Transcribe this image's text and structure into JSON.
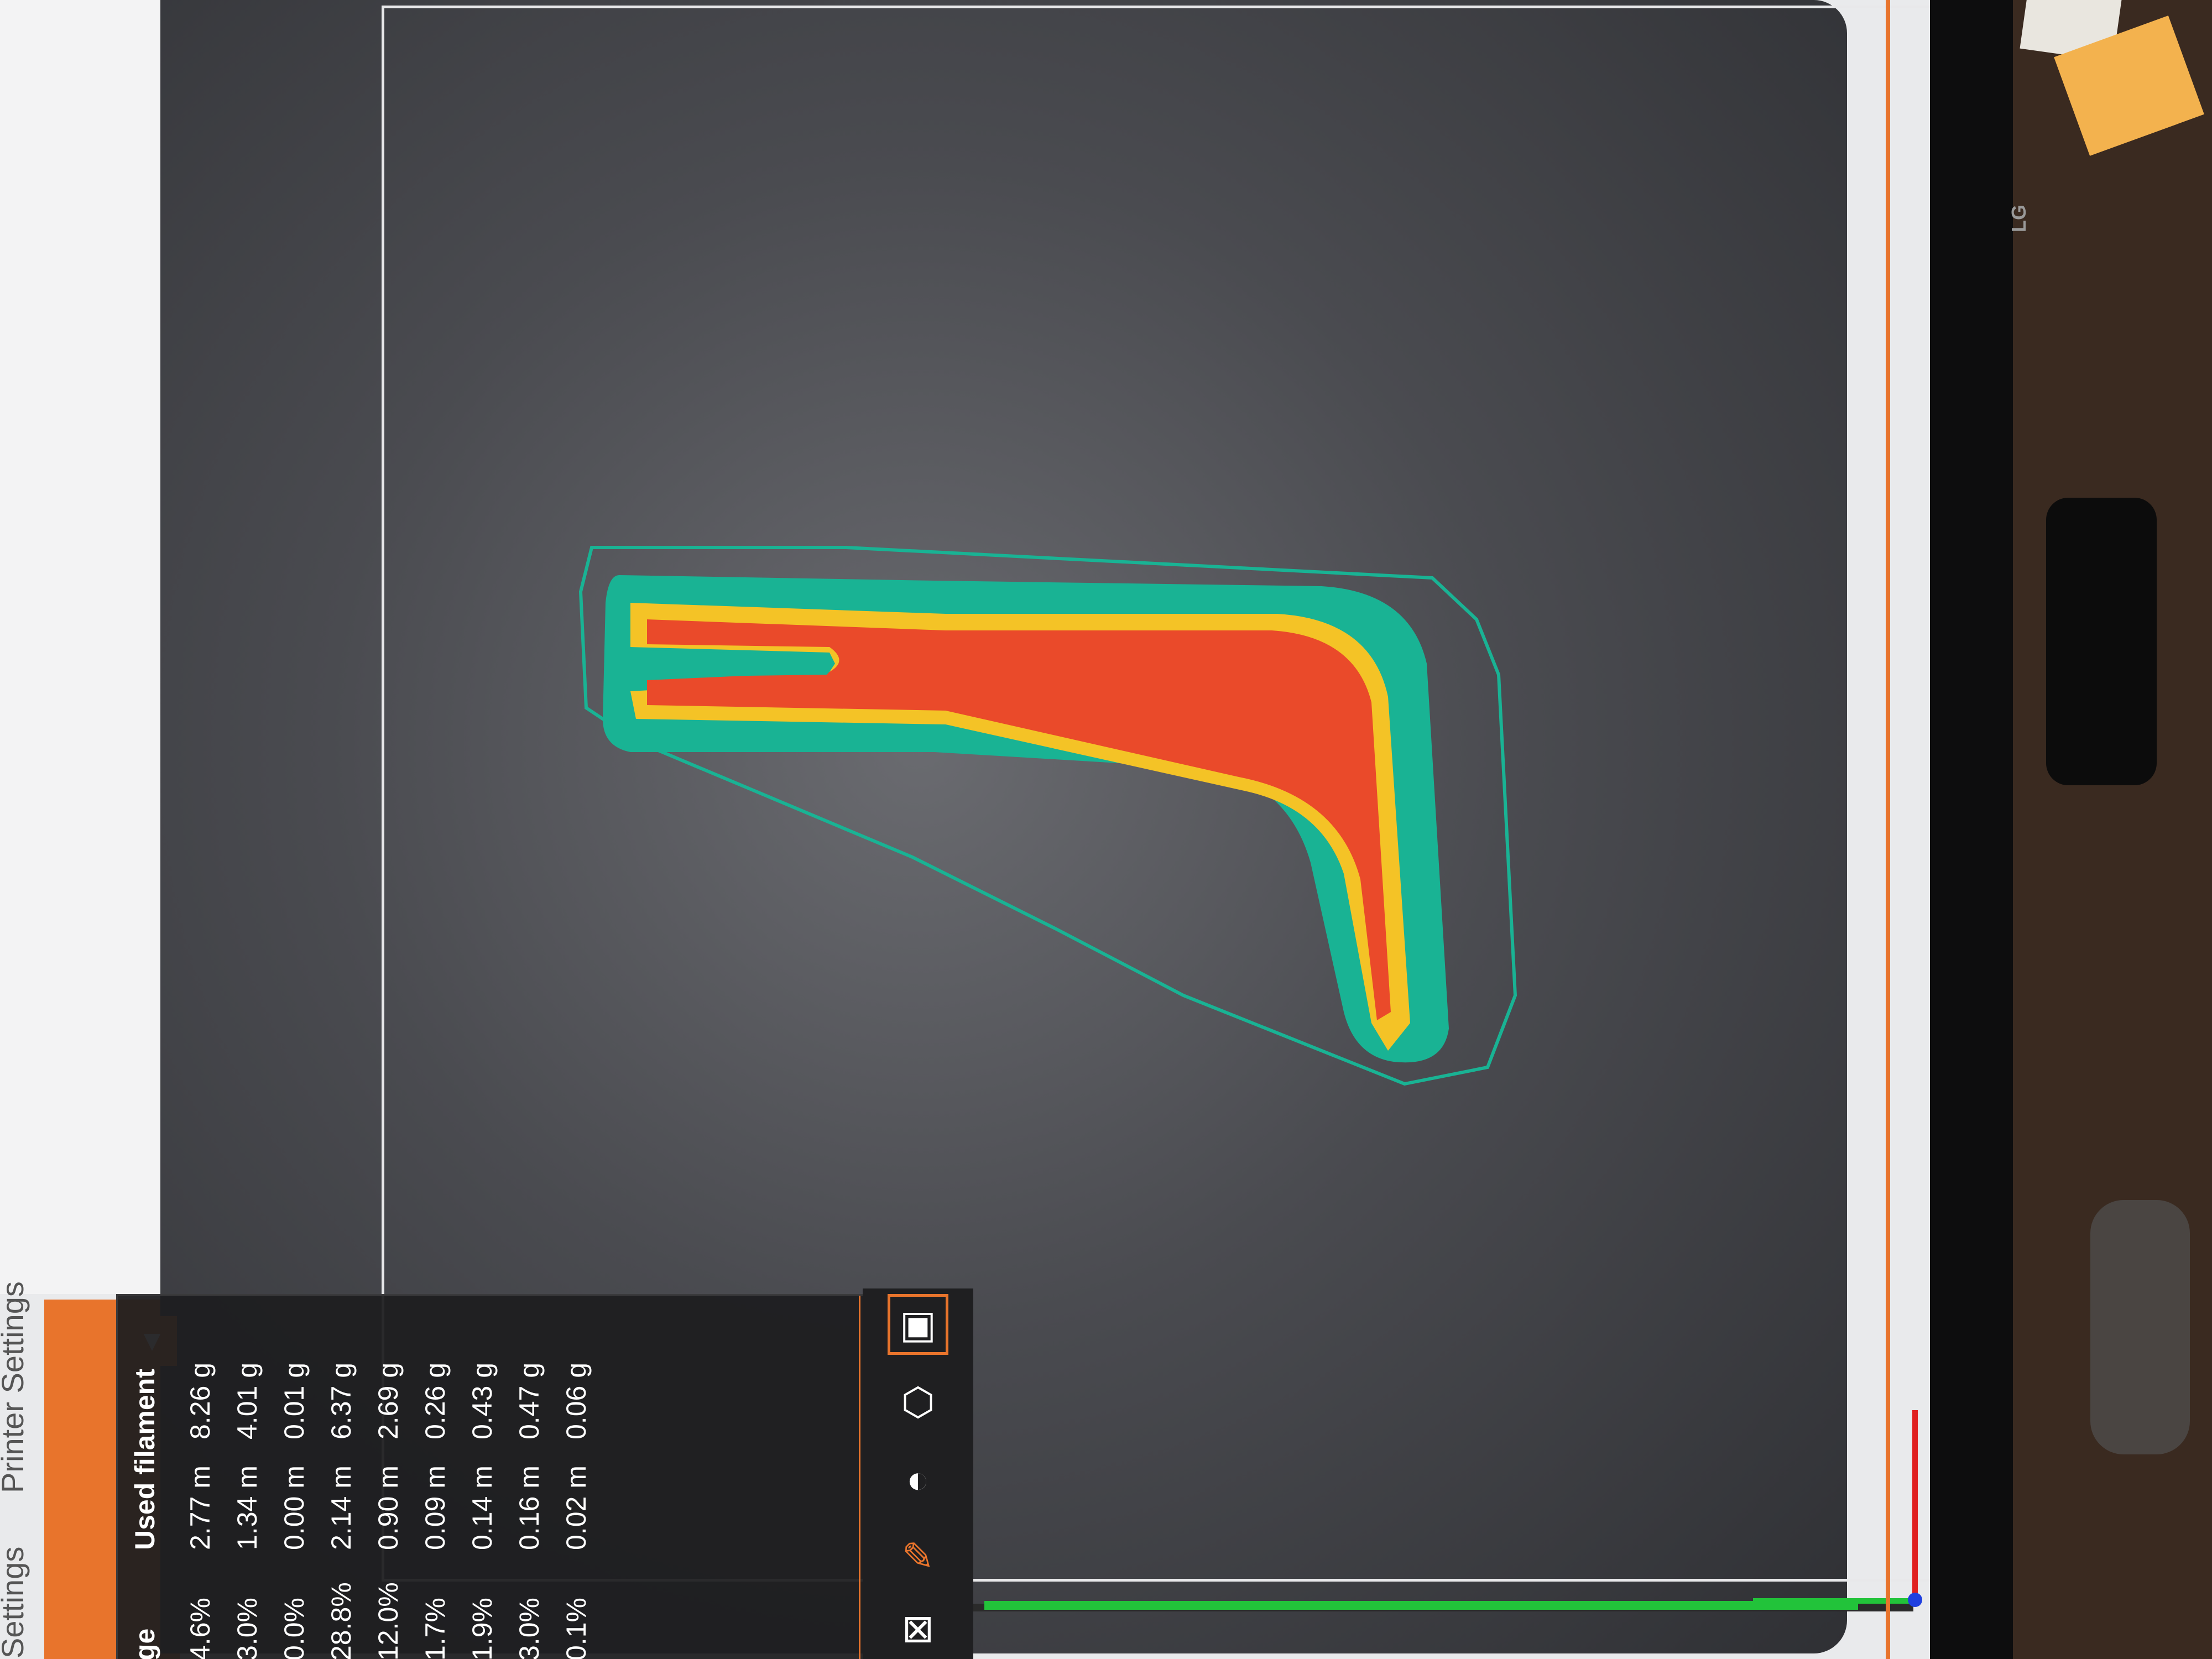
{
  "app": {
    "tabs": [
      {
        "label": "Settings"
      },
      {
        "label": "Printer Settings"
      }
    ],
    "collapse_icon": "triangle-down-icon"
  },
  "legend": {
    "header_left": "ge",
    "header_right": "Used filament",
    "rows": [
      {
        "pct": "4.6%",
        "len": "2.77 m",
        "wt": "8.26 g"
      },
      {
        "pct": "3.0%",
        "len": "1.34 m",
        "wt": "4.01 g"
      },
      {
        "pct": "0.0%",
        "len": "0.00 m",
        "wt": "0.01 g"
      },
      {
        "pct": "28.8%",
        "len": "2.14 m",
        "wt": "6.37 g"
      },
      {
        "pct": "12.0%",
        "len": "0.90 m",
        "wt": "2.69 g"
      },
      {
        "pct": "1.7%",
        "len": "0.09 m",
        "wt": "0.26 g"
      },
      {
        "pct": "1.9%",
        "len": "0.14 m",
        "wt": "0.43 g"
      },
      {
        "pct": "3.0%",
        "len": "0.16 m",
        "wt": "0.47 g"
      },
      {
        "pct": "0.1%",
        "len": "0.02 m",
        "wt": "0.06 g"
      }
    ]
  },
  "toolbar_icons": [
    "orientation-icon",
    "cube-icon",
    "balance-icon",
    "tools-icon",
    "measure-icon"
  ],
  "monitor": {
    "brand": "LG"
  },
  "colors": {
    "accent": "#e8742c",
    "infill": "#ea4a2a",
    "perimeter": "#f4c326",
    "skirt_brim": "#19b394",
    "bed_line": "#e8e8ea"
  }
}
